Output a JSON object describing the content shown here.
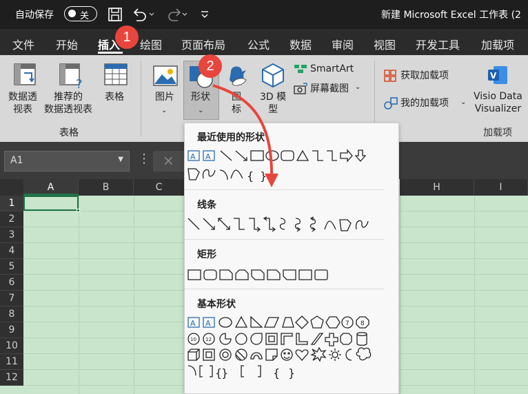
{
  "titlebar": {
    "autosave_label": "自动保存",
    "autosave_state": "关",
    "doc_title": "新建 Microsoft Excel 工作表 (2"
  },
  "tabs": [
    {
      "label": "文件"
    },
    {
      "label": "开始"
    },
    {
      "label": "插入"
    },
    {
      "label": "绘图"
    },
    {
      "label": "页面布局"
    },
    {
      "label": "公式"
    },
    {
      "label": "数据"
    },
    {
      "label": "审阅"
    },
    {
      "label": "视图"
    },
    {
      "label": "开发工具"
    },
    {
      "label": "加载项"
    }
  ],
  "ribbon": {
    "pivot_label": "数据透\n视表",
    "recommended_pivot_label": "推荐的\n数据透视表",
    "table_label": "表格",
    "group_tables": "表格",
    "picture_label": "图片",
    "shapes_label": "形状",
    "icons_label": "图\n标",
    "model3d_label": "3D 模\n型",
    "smartart_label": "SmartArt",
    "screenshot_label": "屏幕截图",
    "get_addins_label": "获取加载项",
    "my_addins_label": "我的加载项",
    "visio_label": "Visio Data\nVisualizer",
    "group_addins": "加载项"
  },
  "formula_bar": {
    "name_box": "A1"
  },
  "grid": {
    "columns": [
      "A",
      "B",
      "C",
      "D",
      "E",
      "F",
      "G",
      "H",
      "I"
    ],
    "rows": [
      "1",
      "2",
      "3",
      "4",
      "5",
      "6",
      "7",
      "8",
      "9",
      "10",
      "11",
      "12"
    ]
  },
  "shapes_menu": {
    "recent": "最近使用的形状",
    "lines": "线条",
    "rectangles": "矩形",
    "basic": "基本形状"
  },
  "callouts": {
    "step1": "1",
    "step2": "2"
  },
  "colors": {
    "accent": "#217346",
    "callout": "#e8453c",
    "sheet_bg": "#c9e6cd"
  }
}
